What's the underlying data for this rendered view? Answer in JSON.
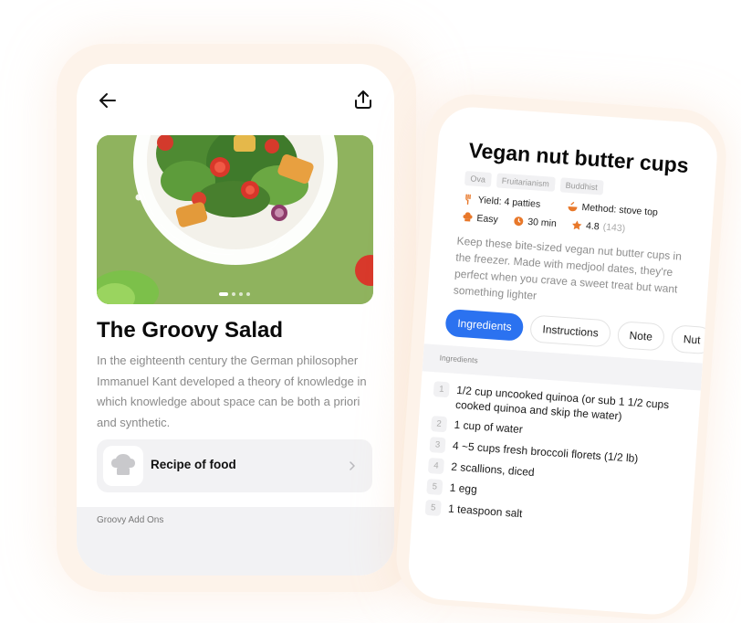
{
  "screen1": {
    "title": "The Groovy Salad",
    "description": "In the eighteenth century the German philosopher Immanuel Kant developed a theory of knowledge in which knowledge about space can be both a priori and synthetic.",
    "recipe_row_label": "Recipe of food",
    "addons_label": "Groovy Add Ons",
    "back_icon": "arrow-left-icon",
    "share_icon": "share-icon",
    "carousel": {
      "pages": 4,
      "active_index": 0
    }
  },
  "screen2": {
    "title": "Vegan nut butter cups",
    "tags": [
      "Ova",
      "Fruitarianism",
      "Buddhist"
    ],
    "yield": "Yield: 4 patties",
    "method": "Method: stove top",
    "difficulty": "Easy",
    "time": "30 min",
    "rating": "4.8",
    "rating_count": "(143)",
    "description": "Keep these bite-sized vegan nut butter cups in the freezer. Made with medjool dates, they're perfect when you crave a sweet treat but want something lighter",
    "tabs": [
      "Ingredients",
      "Instructions",
      "Note",
      "Nut"
    ],
    "active_tab": "Ingredients",
    "ingredients_header": "Ingredients",
    "ingredients": [
      {
        "num": "1",
        "text": "1/2 cup uncooked quinoa (or sub 1 1/2 cups cooked quinoa and skip the water)"
      },
      {
        "num": "2",
        "text": "1 cup of water"
      },
      {
        "num": "3",
        "text": "4 ~5 cups fresh broccoli florets (1/2 lb)"
      },
      {
        "num": "4",
        "text": "2 scallions, diced"
      },
      {
        "num": "5",
        "text": "1 egg"
      },
      {
        "num": "5",
        "text": "1 teaspoon salt"
      }
    ],
    "accent_color": "#2b72f0",
    "meta_icon_color": "#e8782a"
  }
}
